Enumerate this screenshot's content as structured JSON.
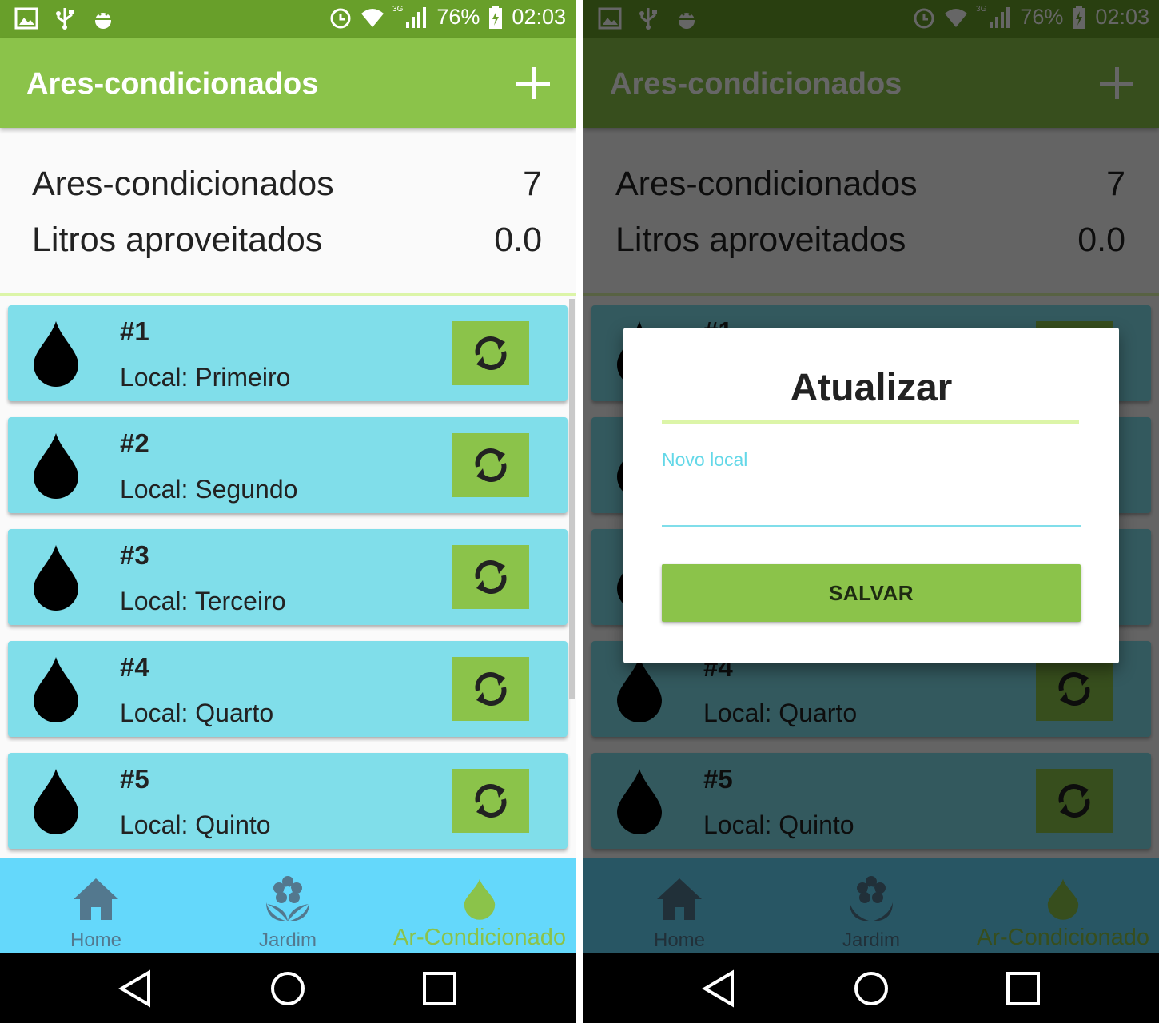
{
  "status_bar": {
    "battery": "76%",
    "time": "02:03",
    "network": "3G",
    "left_icons": [
      "gallery-icon",
      "usb-icon",
      "android-debug-icon"
    ],
    "right_icons": [
      "alarm-icon",
      "wifi-icon",
      "signal-icon",
      "battery-charging-icon"
    ]
  },
  "app_bar": {
    "title": "Ares-condicionados",
    "add_icon": "plus-icon"
  },
  "summary": {
    "rows": [
      {
        "label": "Ares-condicionados",
        "value": "7"
      },
      {
        "label": "Litros aproveitados",
        "value": "0.0"
      }
    ]
  },
  "list": {
    "items": [
      {
        "number": "#1",
        "location": "Local: Primeiro"
      },
      {
        "number": "#2",
        "location": "Local: Segundo"
      },
      {
        "number": "#3",
        "location": "Local: Terceiro"
      },
      {
        "number": "#4",
        "location": "Local: Quarto"
      },
      {
        "number": "#5",
        "location": "Local: Quinto"
      }
    ]
  },
  "bottom_nav": {
    "items": [
      {
        "label": "Home",
        "icon": "home-icon",
        "active": false
      },
      {
        "label": "Jardim",
        "icon": "flower-icon",
        "active": false
      },
      {
        "label": "Ar-Condicionado",
        "icon": "water-drop-icon",
        "active": true
      }
    ]
  },
  "dialog": {
    "title": "Atualizar",
    "field_hint": "Novo local",
    "field_value": "",
    "save_label": "SALVAR"
  },
  "colors": {
    "primary": "#8bc34a",
    "primary_dark": "#689f2a",
    "card": "#80deea",
    "bottom_nav": "#64d8fb",
    "inactive_nav": "#53788e"
  }
}
